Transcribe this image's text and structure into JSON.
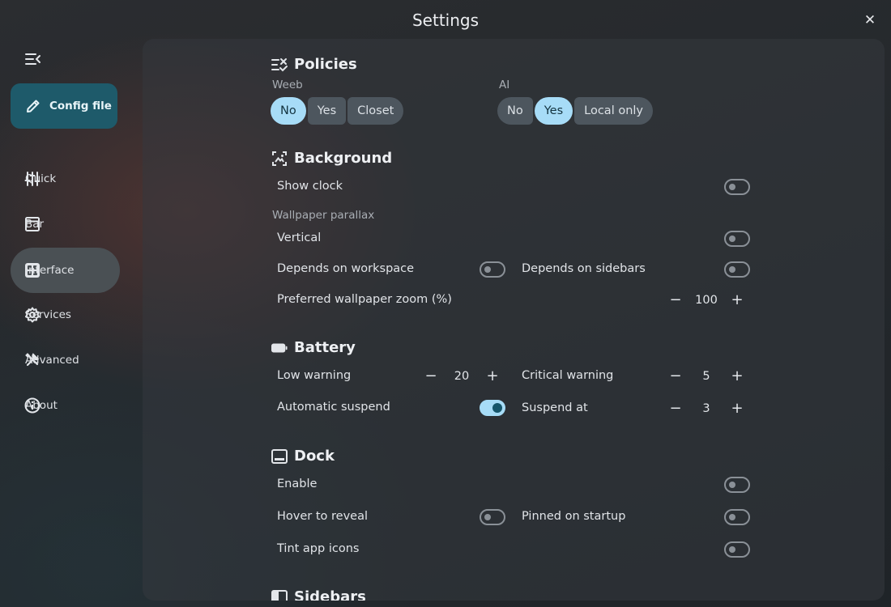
{
  "window": {
    "title": "Settings"
  },
  "sidebar": {
    "config_button": "Config file",
    "items": [
      {
        "label": "Quick",
        "icon": "sliders-icon"
      },
      {
        "label": "Bar",
        "icon": "bar-window-icon"
      },
      {
        "label": "Interface",
        "icon": "grid-icon",
        "active": true
      },
      {
        "label": "Services",
        "icon": "gear-icon"
      },
      {
        "label": "Advanced",
        "icon": "tools-icon"
      },
      {
        "label": "About",
        "icon": "info-icon"
      }
    ]
  },
  "policies": {
    "title": "Policies",
    "weeb": {
      "label": "Weeb",
      "options": [
        "No",
        "Yes",
        "Closet"
      ],
      "selected": "No"
    },
    "ai": {
      "label": "AI",
      "options": [
        "No",
        "Yes",
        "Local only"
      ],
      "selected": "Yes"
    }
  },
  "background": {
    "title": "Background",
    "show_clock": {
      "label": "Show clock",
      "on": false
    },
    "parallax_label": "Wallpaper parallax",
    "vertical": {
      "label": "Vertical",
      "on": false
    },
    "depends_workspace": {
      "label": "Depends on workspace",
      "on": false
    },
    "depends_sidebars": {
      "label": "Depends on sidebars",
      "on": false
    },
    "zoom": {
      "label": "Preferred wallpaper zoom (%)",
      "value": "100"
    }
  },
  "battery": {
    "title": "Battery",
    "low_warning": {
      "label": "Low warning",
      "value": "20"
    },
    "critical_warning": {
      "label": "Critical warning",
      "value": "5"
    },
    "auto_suspend": {
      "label": "Automatic suspend",
      "on": true
    },
    "suspend_at": {
      "label": "Suspend at",
      "value": "3"
    }
  },
  "dock": {
    "title": "Dock",
    "enable": {
      "label": "Enable",
      "on": false
    },
    "hover_reveal": {
      "label": "Hover to reveal",
      "on": false
    },
    "pinned_startup": {
      "label": "Pinned on startup",
      "on": false
    },
    "tint_icons": {
      "label": "Tint app icons",
      "on": false
    }
  },
  "sidebars": {
    "title": "Sidebars"
  },
  "colors": {
    "accent": "#a7dcf7",
    "accent_dark": "#16566b",
    "config_button": "#1e5a6a",
    "active_nav": "#4a5054"
  }
}
